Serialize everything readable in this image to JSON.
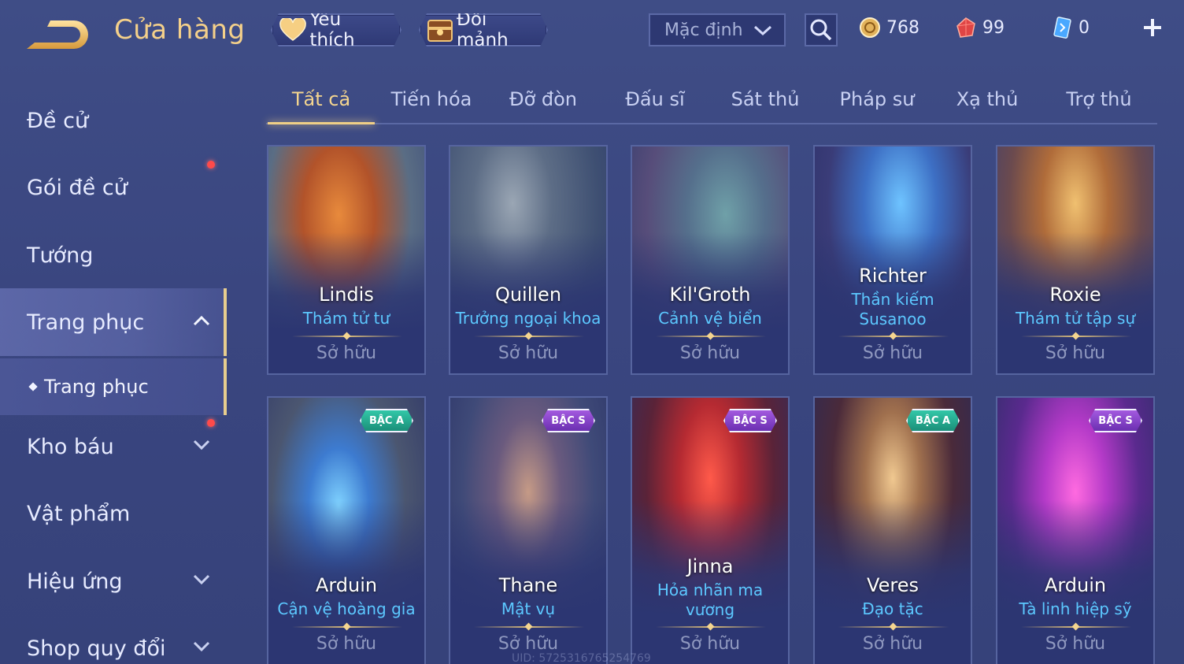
{
  "header": {
    "title": "Cửa hàng",
    "favorite_label": "Yêu thích",
    "shard_label": "Đổi mảnh",
    "sort_value": "Mặc định",
    "currencies": {
      "gold": "768",
      "ruby": "99",
      "card": "0"
    }
  },
  "sidebar": {
    "items": [
      {
        "label": "Đề cử"
      },
      {
        "label": "Gói đề cử"
      },
      {
        "label": "Tướng"
      },
      {
        "label": "Trang phục"
      },
      {
        "label": "Kho báu"
      },
      {
        "label": "Vật phẩm"
      },
      {
        "label": "Hiệu ứng"
      },
      {
        "label": "Shop quy đổi"
      }
    ],
    "sub_item": "Trang phục"
  },
  "tabs": [
    {
      "label": "Tất cả"
    },
    {
      "label": "Tiến hóa"
    },
    {
      "label": "Đỡ đòn"
    },
    {
      "label": "Đấu sĩ"
    },
    {
      "label": "Sát thủ"
    },
    {
      "label": "Pháp sư"
    },
    {
      "label": "Xạ thủ"
    },
    {
      "label": "Trợ thủ"
    }
  ],
  "skins": [
    {
      "hero": "Lindis",
      "skin": "Thám tử tư",
      "status": "Sở hữu",
      "rank": ""
    },
    {
      "hero": "Quillen",
      "skin": "Trưởng ngoại khoa",
      "status": "Sở hữu",
      "rank": ""
    },
    {
      "hero": "Kil'Groth",
      "skin": "Cảnh vệ biển",
      "status": "Sở hữu",
      "rank": ""
    },
    {
      "hero": "Richter",
      "skin": "Thần kiếm Susanoo",
      "skin_line1": "Thần kiếm",
      "skin_line2": "Susanoo",
      "status": "Sở hữu",
      "rank": ""
    },
    {
      "hero": "Roxie",
      "skin": "Thám tử tập sự",
      "status": "Sở hữu",
      "rank": ""
    },
    {
      "hero": "Arduin",
      "skin": "Cận vệ hoàng gia",
      "status": "Sở hữu",
      "rank": "BẬC A"
    },
    {
      "hero": "Thane",
      "skin": "Mật vụ",
      "status": "Sở hữu",
      "rank": "BẬC S"
    },
    {
      "hero": "Jinna",
      "skin": "Hỏa nhãn ma vương",
      "skin_line1": "Hỏa nhãn ma",
      "skin_line2": "vương",
      "status": "Sở hữu",
      "rank": "BẬC S"
    },
    {
      "hero": "Veres",
      "skin": "Đạo tặc",
      "status": "Sở hữu",
      "rank": "BẬC A"
    },
    {
      "hero": "Arduin",
      "skin": "Tà linh hiệp sỹ",
      "status": "Sở hữu",
      "rank": "BẬC S"
    }
  ],
  "footer": {
    "uid": "UID: 5725316765254769"
  },
  "colors": {
    "accent_gold": "#f4d58f",
    "skin_name_blue": "#5cc8ff",
    "notification_red": "#ff4a4a",
    "rank_a": "#1b8f79",
    "rank_s": "#6b2fb1"
  }
}
